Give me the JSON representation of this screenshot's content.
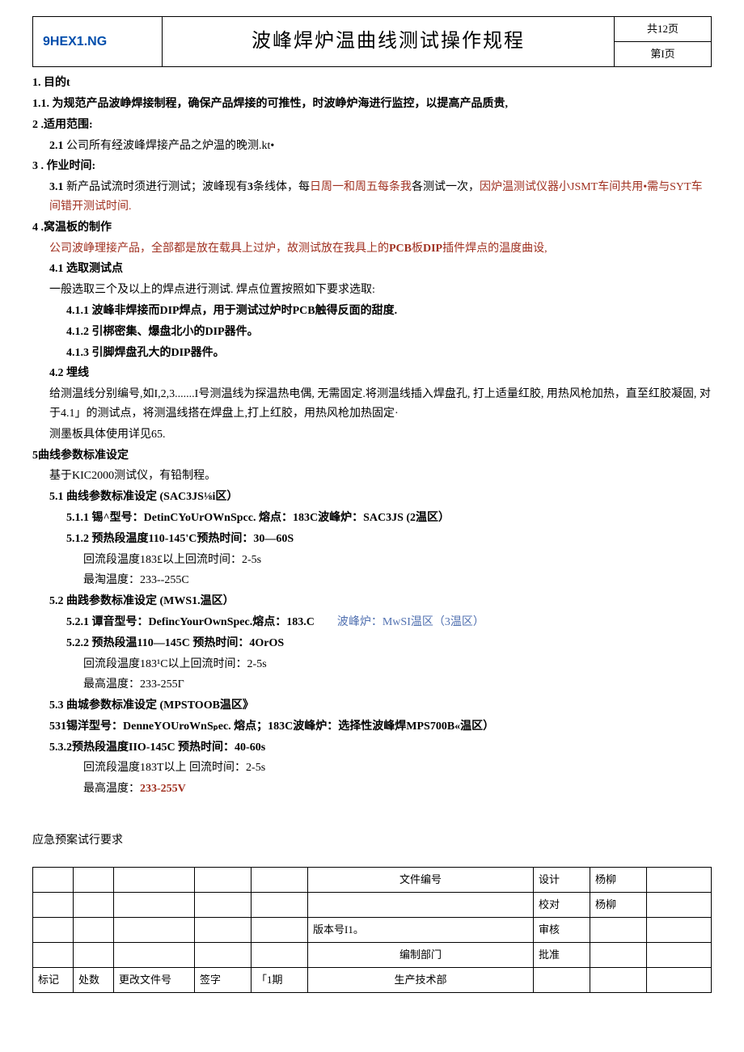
{
  "header": {
    "doc_code": "9HEX1.NG",
    "title": "波峰焊炉温曲线测试操作规程",
    "page_total": "共12页",
    "page_current": "第I页"
  },
  "section1": {
    "heading": "1. 目的t",
    "p1": "1.1. 为规范产品波峥焊接制程，确保产品焊接的可推性，时波峥炉海进行监控，以提高产品质贵,"
  },
  "section2": {
    "heading": "2   .适用范围:",
    "p1_bold": "2.1",
    "p1_rest": "   公司所有经波峰焊接产品之炉温的晚测.kt•"
  },
  "section3": {
    "heading": "3    . 作业时间:",
    "p1_a": "3.1",
    "p1_b": "   新产品试流时须进行测试；波峰现有",
    "p1_c": "3",
    "p1_d": "条线体，每",
    "p1_red1": "日周一和周五每条我",
    "p1_e": "各测试一次，",
    "p1_red2": "因炉温测试仪器小JSMT车间共用•需与SYT车间错开测试时间."
  },
  "section4": {
    "heading": "4   .窝温板的制作",
    "red_line_a": "公司波峥理接产品，全部都是放在载具上过炉，故测试放在我具上的",
    "red_line_b": "PCB",
    "red_line_c": "板",
    "red_line_d": "DIP",
    "red_line_e": "插件焊点的温度曲设,",
    "s41": "4.1   选取测试点",
    "s41_body": "一般选取三个及以上的焊点进行测试. 焊点位置按照如下要求选取:",
    "s411": "4.1.1   波峰非焊接而DIP焊点，用于测试过炉时PCB触得反面的甜度.",
    "s412": "4.1.2   引梆密集、爆盘北小的DIP器件。",
    "s413": "4.1.3   引脚焊盘孔大的DIP器件。",
    "s42": "4.2  埋线",
    "s42_body1": "给测温线分别编号,如I,2,3.......I号测温线为探温热电偶, 无需固定.将测温线插入焊盘孔, 打上适量红胶, 用热风枪加热，直至红胶凝固, 对于4.1」的测试点，将测温线搭在焊盘上,打上红胶，用热风枪加热固定·",
    "s42_body2": "测墨板具体使用详见65."
  },
  "section5": {
    "heading": "5曲线参数标准设定",
    "intro": "基于KIC2000测试仪，有铅制程。",
    "s51": "5.1   曲线参数标准设定 (SAC3JS⅛i区）",
    "s511": "5.1.1  锡^型号：DetinCYoUrOWnSpcc.        熔点：183C波峰炉：SAC3JS (2温区）",
    "s512": "5.1.2  预热段温度110-145'C预热时间：30—60S",
    "s512b": "回流段温度183£以上回流时间：2-5s",
    "s512c": "最淘温度：233--255C",
    "s52": "5.2    曲践参数标准设定 (MWS1.温区）",
    "s521a": "5.2.1  谭音型号：DefincYourOwnSpec.熔点：183.C",
    "s521b": "波峰炉：MwSI温区（3温区）",
    "s522": "5.2.2  预热段温110—145C       预热时间：4OrOS",
    "s522b": "回流段温度183¹C以上回流时间：2-5s",
    "s522c": "最高温度：233-255Γ",
    "s53": "5.3    曲城参数标准设定 (MPSTOOB温区》",
    "s531": "531锡洋型号：DenneYOUroWnSₚec.            熔点；183C波峰炉：选择性波峰焊MPS700B«温区）",
    "s532": "5.3.2预热段温度IIO-145C       预热时间：40-60s",
    "s532b": "回流段温度183T以上       回流时间：2-5s",
    "s532c_a": "最高温度：",
    "s532c_b": "233-255V"
  },
  "footer_heading": "应急预案试行要求",
  "footer_table": {
    "r1_c6": "文件编号",
    "r1_c7": "设计",
    "r1_c8": "杨柳",
    "r2_c7": "校对",
    "r2_c8": "杨柳",
    "r3_c6": "版本号I1。",
    "r3_c7": "审核",
    "r4_c6": "编制部门",
    "r4_c7": "批准",
    "r5_c1": "标记",
    "r5_c2": "处数",
    "r5_c3": "更改文件号",
    "r5_c4": "签字",
    "r5_c5": "「1期",
    "r5_c6": "生产技术部"
  }
}
